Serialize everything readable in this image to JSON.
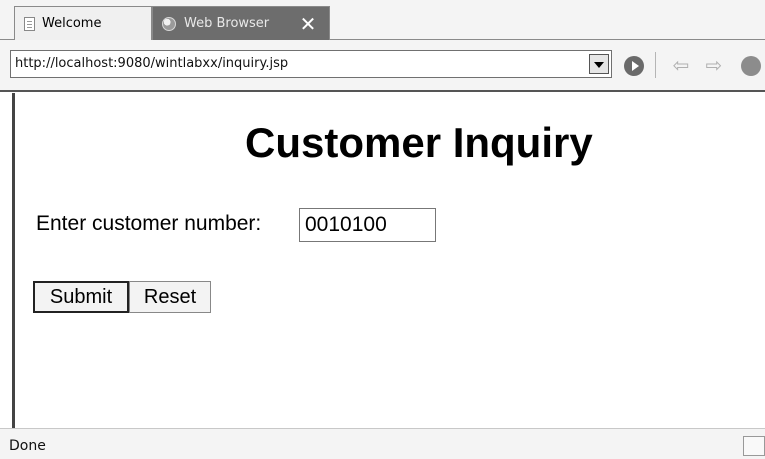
{
  "tabs": [
    {
      "label": "Welcome",
      "icon": "document-icon",
      "active": false
    },
    {
      "label": "Web Browser",
      "icon": "globe-icon",
      "active": true
    }
  ],
  "toolbar": {
    "url": "http://localhost:9080/wintlabxx/inquiry.jsp",
    "icons": [
      "dropdown-arrow-icon",
      "go-icon",
      "back-arrow-icon",
      "forward-arrow-icon",
      "stop-icon"
    ]
  },
  "page": {
    "title": "Customer Inquiry",
    "field_label": "Enter customer number:",
    "customer_number": "0010100",
    "submit_label": "Submit",
    "reset_label": "Reset"
  },
  "status": {
    "text": "Done"
  }
}
